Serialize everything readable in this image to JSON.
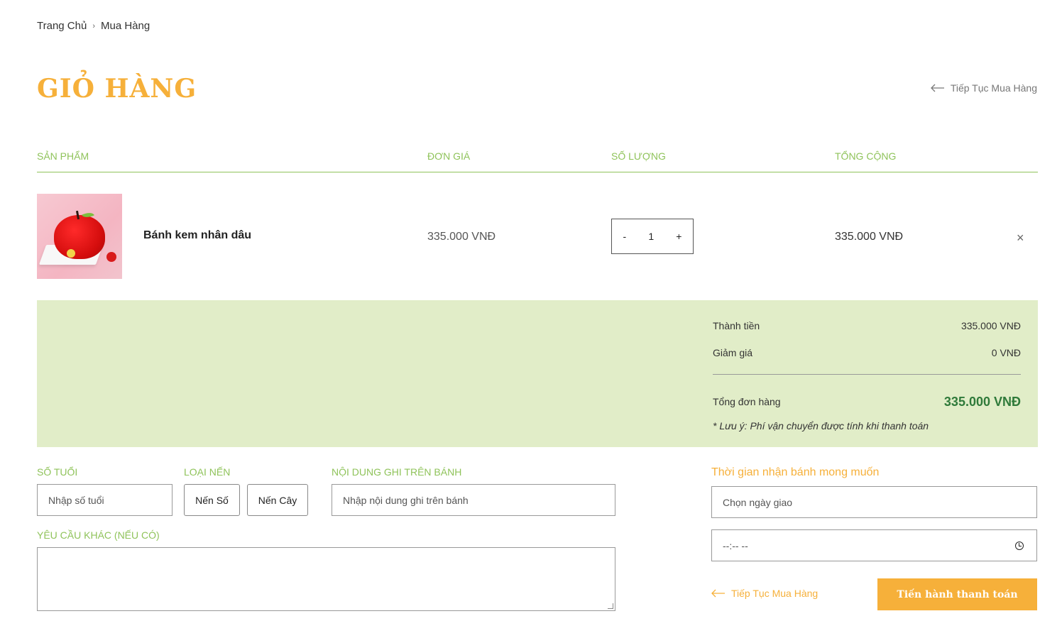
{
  "breadcrumb": {
    "home": "Trang Chủ",
    "separator": "›",
    "current": "Mua Hàng"
  },
  "title": "GIỎ HÀNG",
  "continue_shopping": "Tiếp Tục Mua Hàng",
  "table_headers": {
    "product": "SẢN PHẨM",
    "unit_price": "ĐƠN GIÁ",
    "quantity": "SỐ LƯỢNG",
    "total": "TỔNG CỘNG"
  },
  "cart_item": {
    "name": "Bánh kem nhân dâu",
    "unit_price": "335.000 VNĐ",
    "qty_minus": "-",
    "quantity": "1",
    "qty_plus": "+",
    "total": "335.000 VNĐ",
    "remove": "×"
  },
  "summary": {
    "subtotal_label": "Thành tiền",
    "subtotal_value": "335.000 VNĐ",
    "discount_label": "Giảm giá",
    "discount_value": "0 VNĐ",
    "total_label": "Tổng đơn hàng",
    "total_value": "335.000 VNĐ",
    "note": "* Lưu ý: Phí vận chuyển được tính khi thanh toán"
  },
  "form": {
    "age_label": "SỐ TUỔI",
    "age_placeholder": "Nhập số tuổi",
    "candle_label": "LOẠI NẾN",
    "candle_number": "Nến Số",
    "candle_stick": "Nến Cây",
    "message_label": "NỘI DUNG GHI TRÊN BÁNH",
    "message_placeholder": "Nhập nội dung ghi trên bánh",
    "other_label": "YÊU CẦU KHÁC (NẾU CÓ)",
    "delivery_label": "Thời gian nhận bánh mong muốn",
    "date_placeholder": "Chọn ngày giao",
    "time_placeholder": "--:-- --"
  },
  "checkout_button": "Tiến hành thanh toán",
  "colors": {
    "accent_orange": "#f6b03a",
    "accent_green": "#8fc35a",
    "summary_bg": "#e1edc8",
    "total_green": "#2f7a3a"
  }
}
